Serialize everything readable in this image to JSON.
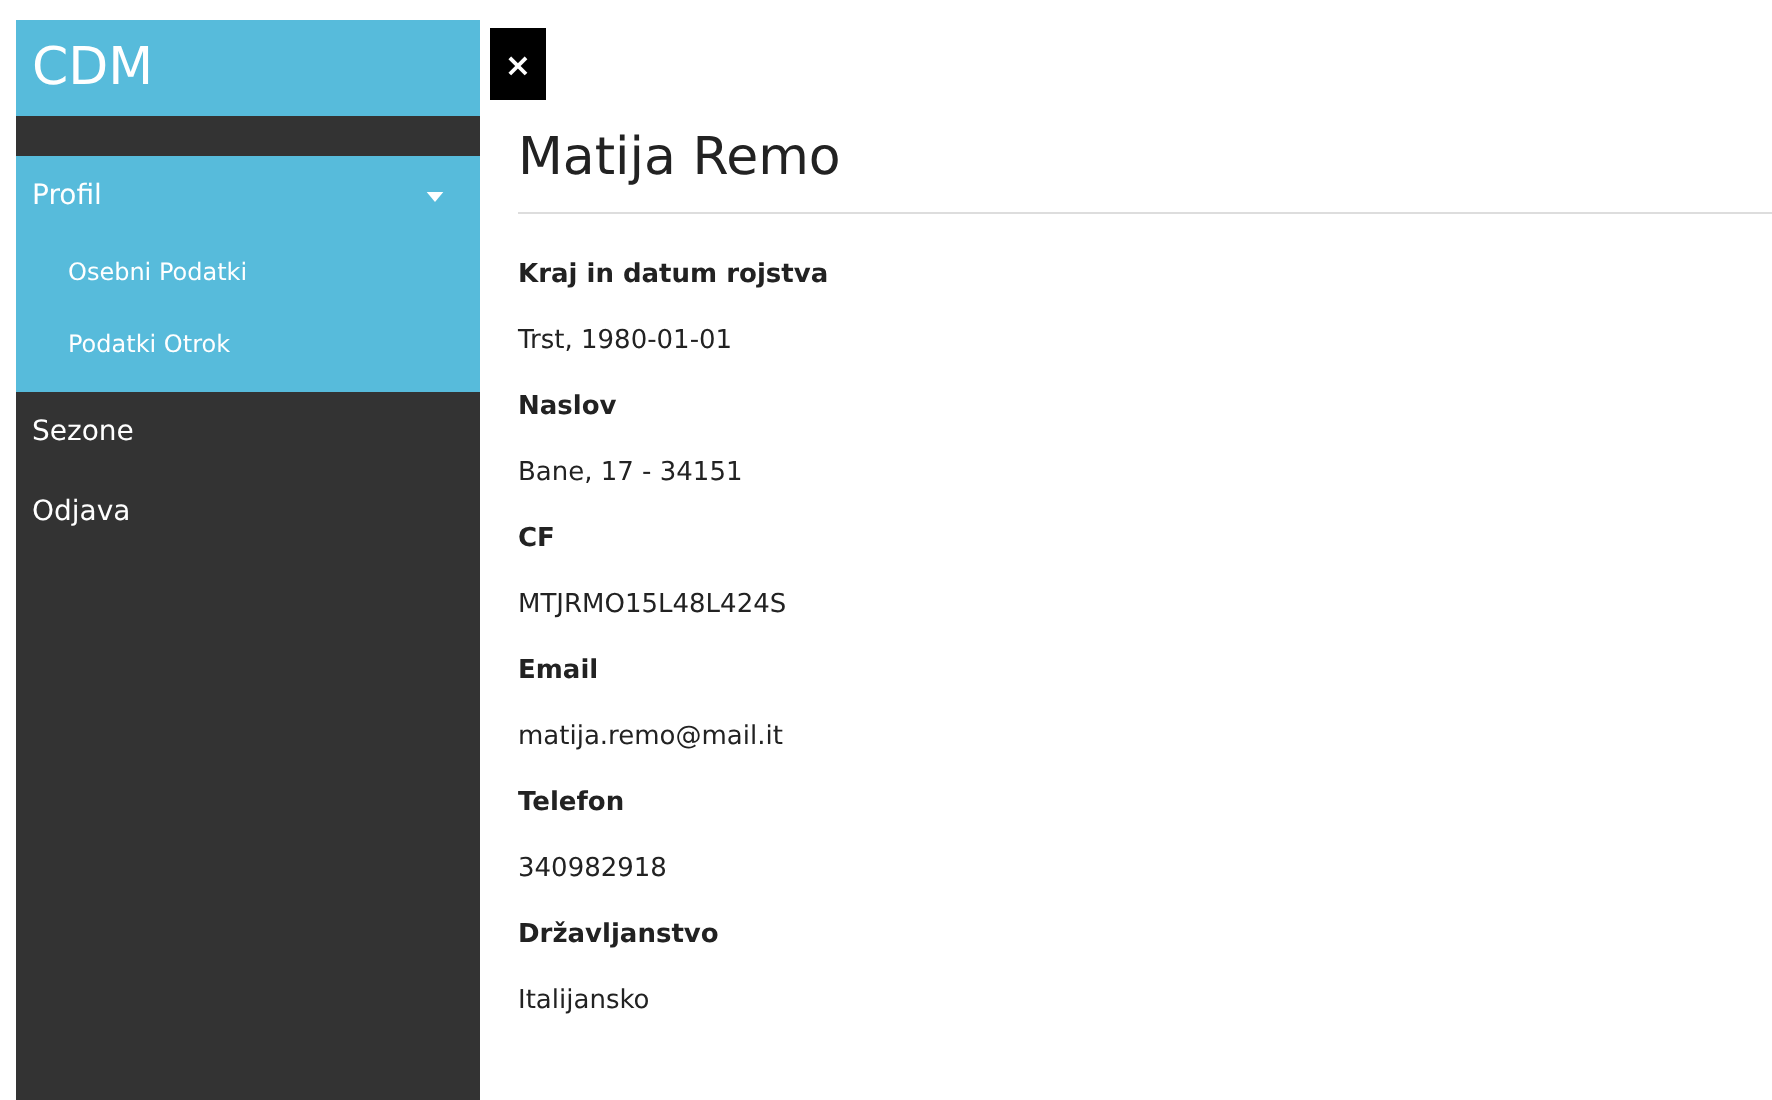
{
  "sidebar": {
    "brand": "CDM",
    "items": [
      {
        "label": "Profil",
        "expanded": true,
        "children": [
          {
            "label": "Osebni Podatki"
          },
          {
            "label": "Podatki Otrok"
          }
        ]
      },
      {
        "label": "Sezone",
        "expanded": false
      },
      {
        "label": "Odjava",
        "expanded": false
      }
    ]
  },
  "close_button": "×",
  "profile": {
    "name": "Matija Remo",
    "fields": [
      {
        "label": "Kraj in datum rojstva",
        "value": "Trst, 1980-01-01"
      },
      {
        "label": "Naslov",
        "value": "Bane, 17 - 34151"
      },
      {
        "label": "CF",
        "value": "MTJRMO15L48L424S"
      },
      {
        "label": "Email",
        "value": "matija.remo@mail.it"
      },
      {
        "label": "Telefon",
        "value": "340982918"
      },
      {
        "label": "Državljanstvo",
        "value": "Italijansko"
      }
    ]
  }
}
